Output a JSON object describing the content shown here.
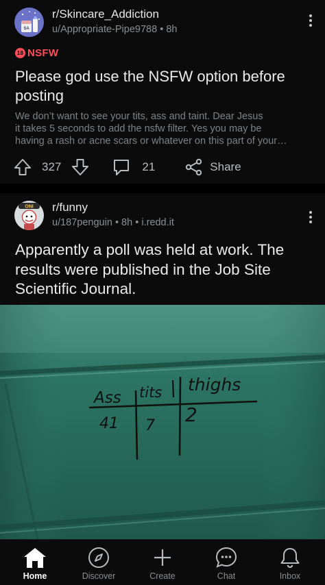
{
  "posts": [
    {
      "subreddit": "r/Skincare_Addiction",
      "author": "u/Appropriate-Pipe9788",
      "age": "8h",
      "nsfw_label": "NSFW",
      "nsfw_badge": "18",
      "title": "Please god use the NSFW option before posting",
      "body_lines": [
        "We don’t want to see your tits, ass and taint. Dear Jesus",
        "it takes 5 seconds to add the nsfw filter. Yes you may be",
        "having a rash or acne scars or whatever on this part of your…"
      ],
      "upvotes": "327",
      "comments": "21",
      "share_label": "Share",
      "avatar_label": "SA"
    },
    {
      "subreddit": "r/funny",
      "author": "u/187penguin",
      "age": "8h",
      "domain": "i.redd.it",
      "title": "Apparently a poll was held at work. The results were published in the Job Site Scientific Journal.",
      "avatar_label": "ONI",
      "image_text": {
        "col1": "Ass",
        "col2": "tits",
        "col3": "thighs",
        "val1": "41",
        "val2": "7",
        "val3": "2"
      }
    }
  ],
  "nav": [
    {
      "label": "Home",
      "icon": "home-icon",
      "active": true
    },
    {
      "label": "Discover",
      "icon": "compass-icon",
      "active": false
    },
    {
      "label": "Create",
      "icon": "plus-icon",
      "active": false
    },
    {
      "label": "Chat",
      "icon": "chat-icon",
      "active": false
    },
    {
      "label": "Inbox",
      "icon": "bell-icon",
      "active": false
    }
  ],
  "colors": {
    "background": "#0b0b0b",
    "nsfw": "#ff4d5a",
    "board_green": "#2f7a6a"
  }
}
